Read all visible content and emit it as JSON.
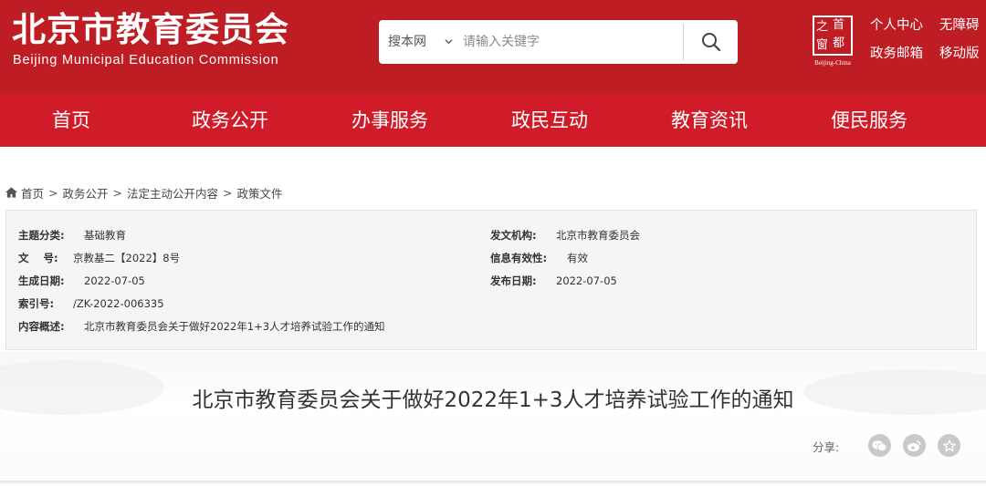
{
  "header": {
    "logo_cn": "北京市教育委员会",
    "logo_en": "Beijing Municipal Education Commission",
    "search": {
      "scope": "搜本网",
      "placeholder": "请输入关键字"
    },
    "seal": {
      "chars": [
        "之",
        "首",
        "窗",
        "都"
      ],
      "en": "Beijing-China"
    },
    "links": {
      "personal_center": "个人中心",
      "accessibility": "无障碍",
      "gov_mail": "政务邮箱",
      "mobile": "移动版"
    }
  },
  "nav": {
    "items": [
      "首页",
      "政务公开",
      "办事服务",
      "政民互动",
      "教育资讯",
      "便民服务"
    ]
  },
  "breadcrumb": {
    "items": [
      "首页",
      "政务公开",
      "法定主动公开内容",
      "政策文件"
    ],
    "separator": ">"
  },
  "info": {
    "topic_label": "主题分类:",
    "topic_value": "基础教育",
    "doc_no_label": "文    号:",
    "doc_no_value": "京教基二【2022】8号",
    "created_label": "生成日期:",
    "created_value": "2022-07-05",
    "index_label": "索引号:",
    "index_value": "/ZK-2022-006335",
    "summary_label": "内容概述:",
    "summary_value": "北京市教育委员会关于做好2022年1+3人才培养试验工作的通知",
    "issuer_label": "发文机构:",
    "issuer_value": "北京市教育委员会",
    "validity_label": "信息有效性:",
    "validity_value": "有效",
    "published_label": "发布日期:",
    "published_value": "2022-07-05"
  },
  "article": {
    "title": "北京市教育委员会关于做好2022年1+3人才培养试验工作的通知",
    "share_label": "分享:"
  },
  "colors": {
    "header_red": "#bf1d24",
    "nav_red": "#d01c28",
    "info_bg": "#f5f5f5"
  }
}
